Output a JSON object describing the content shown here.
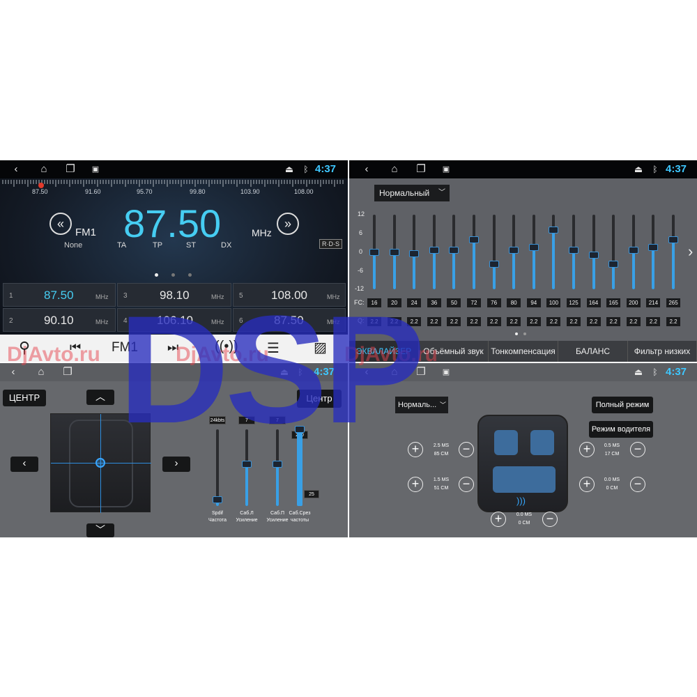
{
  "status": {
    "time": "4:37"
  },
  "radio": {
    "scale_labels": [
      "87.50",
      "91.60",
      "95.70",
      "99.80",
      "103.90",
      "108.00"
    ],
    "band": "FM1",
    "ps": "None",
    "frequency": "87.50",
    "unit": "MHz",
    "flags": [
      "TA",
      "TP",
      "ST",
      "DX"
    ],
    "rds": "R·D·S",
    "presets": [
      {
        "num": "1",
        "freq": "87.50",
        "unit": "MHz"
      },
      {
        "num": "2",
        "freq": "90.10",
        "unit": "MHz"
      },
      {
        "num": "3",
        "freq": "98.10",
        "unit": "MHz"
      },
      {
        "num": "4",
        "freq": "106.10",
        "unit": "MHz"
      },
      {
        "num": "5",
        "freq": "108.00",
        "unit": "MHz"
      },
      {
        "num": "6",
        "freq": "87.50",
        "unit": "MHz"
      }
    ],
    "toolbar_band": "FM1"
  },
  "eq": {
    "preset": "Нормальный",
    "y_ticks": [
      "12",
      "6",
      "0",
      "-6",
      "-12"
    ],
    "fc_label": "FC:",
    "q_label": "Q:",
    "fc": [
      "16",
      "20",
      "24",
      "36",
      "50",
      "72",
      "76",
      "80",
      "94",
      "100",
      "125",
      "164",
      "165",
      "200",
      "214",
      "265"
    ],
    "q": [
      "2.2",
      "2.2",
      "2.2",
      "2.2",
      "2.2",
      "2.2",
      "2.2",
      "2.2",
      "2.2",
      "2.2",
      "2.2",
      "2.2",
      "2.2",
      "2.2",
      "2.2",
      "2.2"
    ],
    "gains": [
      0,
      0,
      -0.5,
      0.5,
      0.5,
      4,
      -4,
      0.5,
      1.5,
      7,
      0.5,
      -1,
      -4,
      0.5,
      1.5,
      4
    ],
    "tabs": [
      "ЭКВАЛАЙЗЕР",
      "Объёмный звук",
      "Тонкомпенсация",
      "БАЛАНС",
      "Фильтр низких"
    ]
  },
  "balance": {
    "center_left": "ЦЕНТР",
    "center_right": "Центр",
    "sliders": [
      {
        "top_value": "24kbts",
        "label1": "Spdif",
        "label2": "Частота",
        "level": 0.08
      },
      {
        "top_value": "7",
        "label1": "Саб.Л",
        "label2": "Усиление",
        "level": 0.55
      },
      {
        "top_value": "7",
        "label1": "Саб.П",
        "label2": "Усиление",
        "level": 0.55
      },
      {
        "top_value": "250",
        "label1": "Саб.Срез",
        "label2": "частоты",
        "level": 1.0,
        "bottom_value": "25"
      }
    ]
  },
  "delay": {
    "preset": "Нормаль...",
    "full_mode": "Полный режим",
    "driver_mode": "Режим водителя",
    "fl": {
      "ms": "2.5 MS",
      "cm": "85 CM"
    },
    "fr": {
      "ms": "0.5 MS",
      "cm": "17 CM"
    },
    "rl": {
      "ms": "1.5 MS",
      "cm": "51 CM"
    },
    "rr": {
      "ms": "0.0 MS",
      "cm": "0 CM"
    },
    "sub": {
      "ms": "0.0 MS",
      "cm": "0 CM"
    }
  },
  "overlay": {
    "dsp": "DSP",
    "watermark": "DjAvto.ru"
  }
}
